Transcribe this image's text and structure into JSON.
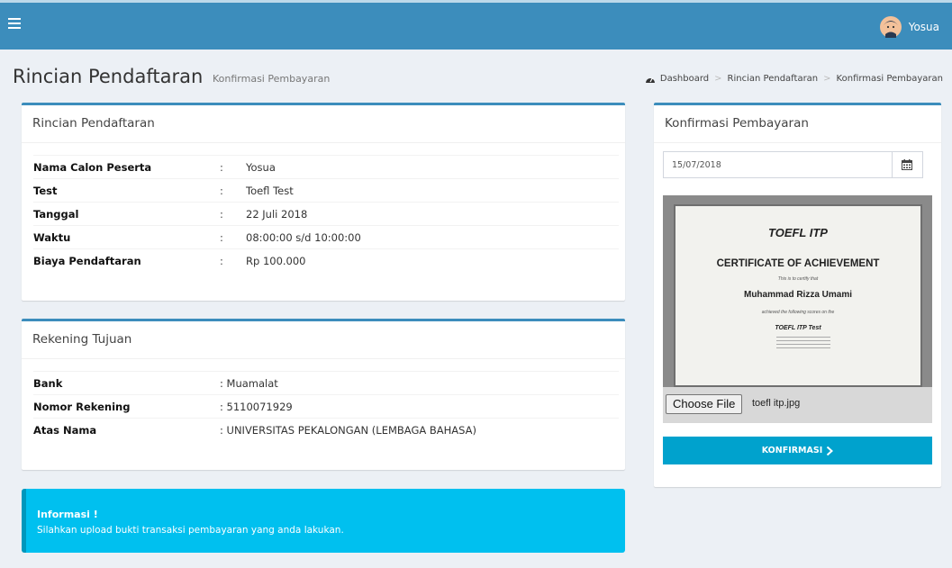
{
  "header": {
    "menu_icon": "hamburger-icon",
    "user_name": "Yosua",
    "brand_color": "#3c8dbc"
  },
  "page": {
    "title": "Rincian Pendaftaran",
    "subtitle": "Konfirmasi Pembayaran",
    "breadcrumb": [
      "Dashboard",
      "Rincian Pendaftaran",
      "Konfirmasi Pembayaran"
    ]
  },
  "registration": {
    "title": "Rincian Pendaftaran",
    "rows": [
      {
        "label": "Nama Calon Peserta",
        "colon": ":",
        "value": "Yosua"
      },
      {
        "label": "Test",
        "colon": ":",
        "value": "Toefl Test"
      },
      {
        "label": "Tanggal",
        "colon": ":",
        "value": "22 Juli 2018"
      },
      {
        "label": "Waktu",
        "colon": ":",
        "value": "08:00:00 s/d 10:00:00"
      },
      {
        "label": "Biaya Pendaftaran",
        "colon": ":",
        "value": "Rp 100.000"
      }
    ]
  },
  "account": {
    "title": "Rekening Tujuan",
    "rows": [
      {
        "label": "Bank",
        "value": ": Muamalat"
      },
      {
        "label": "Nomor Rekening",
        "value": ": 5110071929"
      },
      {
        "label": "Atas Nama",
        "value": ": UNIVERSITAS PEKALONGAN (LEMBAGA BAHASA)"
      }
    ]
  },
  "info": {
    "title": "Informasi !",
    "message": "Silahkan upload bukti transaksi pembayaran yang anda lakukan.",
    "color": "#00c0ef"
  },
  "confirm": {
    "title": "Konfirmasi Pembayaran",
    "date_value": "15/07/2018",
    "calendar_icon": "calendar-icon",
    "certificate": {
      "brand": "TOEFL ITP",
      "heading": "CERTIFICATE OF ACHIEVEMENT",
      "certify": "This is to certify that",
      "name": "Muhammad Rizza Umami",
      "achieved": "achieved the following scores on the",
      "test": "TOEFL ITP Test"
    },
    "choose_file_label": "Choose File",
    "file_name": "toefl itp.jpg",
    "button_label": "KONFIRMASI",
    "button_color": "#00a2cd"
  }
}
